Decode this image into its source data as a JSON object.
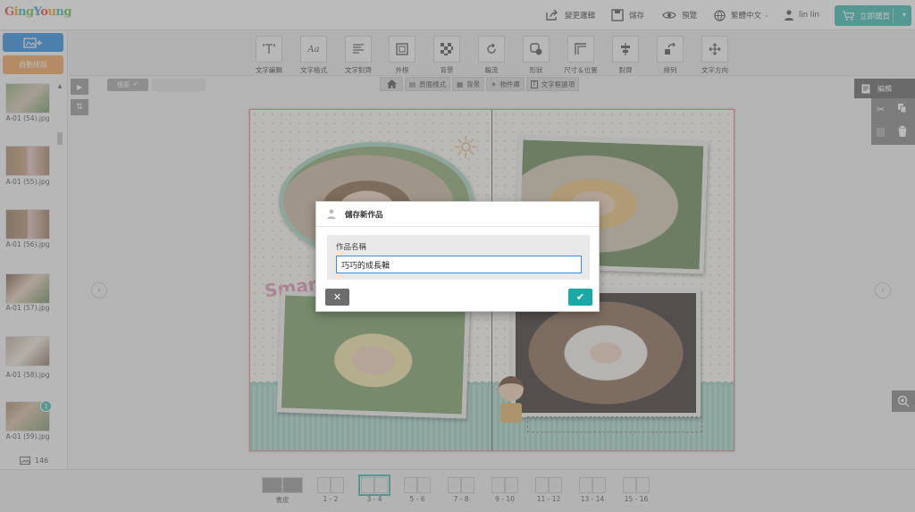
{
  "app": {
    "logo_text": "GingYoung",
    "logo_colors": [
      "#e84c3d",
      "#f3a21a",
      "#3dbdb2",
      "#6cc24a",
      "#3aa0d8"
    ]
  },
  "topbar": {
    "share_label": "變更邏輯",
    "save_label": "儲存",
    "preview_label": "預覽",
    "language_label": "繁體中文",
    "user_name": "lin lin",
    "buy_label": "立即購買"
  },
  "colors": {
    "accent": "#3dbdb2",
    "upload_blue": "#2f8ee0",
    "autofill_orange": "#f0a45c",
    "badge_teal": "#3dbdb2"
  },
  "left_panel": {
    "upload_label": "",
    "autofill_label": "自動排版",
    "image_count": "146",
    "images": [
      {
        "name": "A-01 (54).jpg"
      },
      {
        "name": "A-01 (55).jpg"
      },
      {
        "name": "A-01 (56).jpg"
      },
      {
        "name": "A-01 (57).jpg"
      },
      {
        "name": "A-01 (58).jpg"
      },
      {
        "name": "A-01 (59).jpg",
        "badge": "1"
      }
    ]
  },
  "toolbar": {
    "items": [
      {
        "label": "文字編輯",
        "icon": "text-edit-icon"
      },
      {
        "label": "文字格式",
        "icon": "text-format-icon",
        "glyph": "Aa"
      },
      {
        "label": "文字對齊",
        "icon": "text-align-icon"
      },
      {
        "label": "外框",
        "icon": "frame-icon"
      },
      {
        "label": "背景",
        "icon": "background-icon"
      },
      {
        "label": "輪流",
        "icon": "rotate-icon"
      },
      {
        "label": "形狀",
        "icon": "shape-icon"
      },
      {
        "label": "尺寸＆位置",
        "icon": "size-position-icon"
      },
      {
        "label": "對齊",
        "icon": "align-icon"
      },
      {
        "label": "排列",
        "icon": "arrange-icon"
      },
      {
        "label": "文字方向",
        "icon": "text-direction-icon"
      }
    ]
  },
  "canvas_tabs": {
    "undo_label": "復原",
    "items": [
      {
        "label": "頁面樣式"
      },
      {
        "label": "背景"
      },
      {
        "label": "物件庫"
      },
      {
        "label": "文字框選項"
      }
    ]
  },
  "right_panel": {
    "edit_label": "編輯"
  },
  "spread": {
    "sticker_text": "Smart"
  },
  "dialog": {
    "title": "儲存新作品",
    "field_label": "作品名稱",
    "field_value": "巧巧的成長輯"
  },
  "pages": {
    "items": [
      {
        "label": "書皮"
      },
      {
        "label": "1 - 2"
      },
      {
        "label": "3 - 4",
        "selected": true
      },
      {
        "label": "5 - 6"
      },
      {
        "label": "7 - 8"
      },
      {
        "label": "9 - 10"
      },
      {
        "label": "11 - 12"
      },
      {
        "label": "13 - 14"
      },
      {
        "label": "15 - 16"
      }
    ]
  }
}
